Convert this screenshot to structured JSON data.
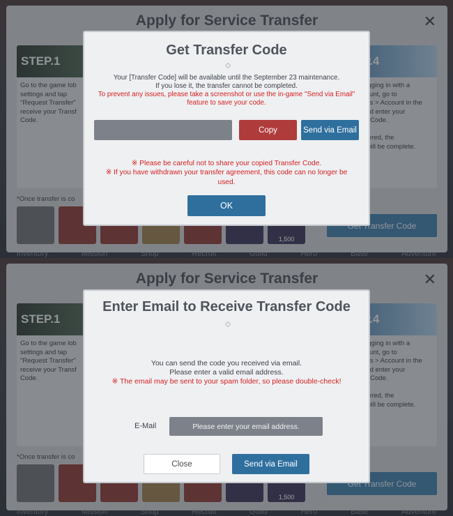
{
  "apply_window": {
    "title": "Apply for Service Transfer",
    "close_glyph": "✕",
    "step1_label": "STEP.1",
    "step1_text": "Go to the game lob\nsettings and tap\n\"Request Transfer\"\nreceive your Transf\nCode.",
    "step4_label": "P.4",
    "step4_text": "logging in with a\ncount, go to\nngs > Account in the\nand enter your\ner Code.\n\nntered, the\nr will be complete.",
    "once_text": "*Once transfer is co",
    "item_count": "1,500",
    "get_code_label": "Get Transfer Code"
  },
  "bottom_nav": [
    "Inventory",
    "Mission",
    "Shop",
    "Recruit",
    "Guild",
    "Hero",
    "Base",
    "Adventure"
  ],
  "get_code_modal": {
    "title": "Get Transfer Code",
    "line1": "Your [Transfer Code] will be available until the September 23 maintenance.",
    "line2": "If you lose it, the transfer cannot be completed.",
    "line3": "To prevent any issues, please take a screenshot or use the in-game \"Send via Email\" feature to save your code.",
    "copy_label": "Copy",
    "send_email_label": "Send via Email",
    "warning1": "※ Please be careful not to share your copied Transfer Code.",
    "warning2": "※ If you have withdrawn your transfer agreement, this code can no longer be used.",
    "ok_label": "OK"
  },
  "email_modal": {
    "title": "Enter Email to Receive Transfer Code",
    "line1": "You can send the code you received via email.",
    "line2": "Please enter a valid email address.",
    "line3": "※ The email may be sent to your spam folder, so please double-check!",
    "email_label": "E-Mail",
    "email_placeholder": "Please enter your email address.",
    "close_label": "Close",
    "send_label": "Send via Email"
  },
  "colors": {
    "accent_blue": "#2f6f9e",
    "copy_red": "#b03b3b",
    "warning_red": "#d61f1f"
  }
}
